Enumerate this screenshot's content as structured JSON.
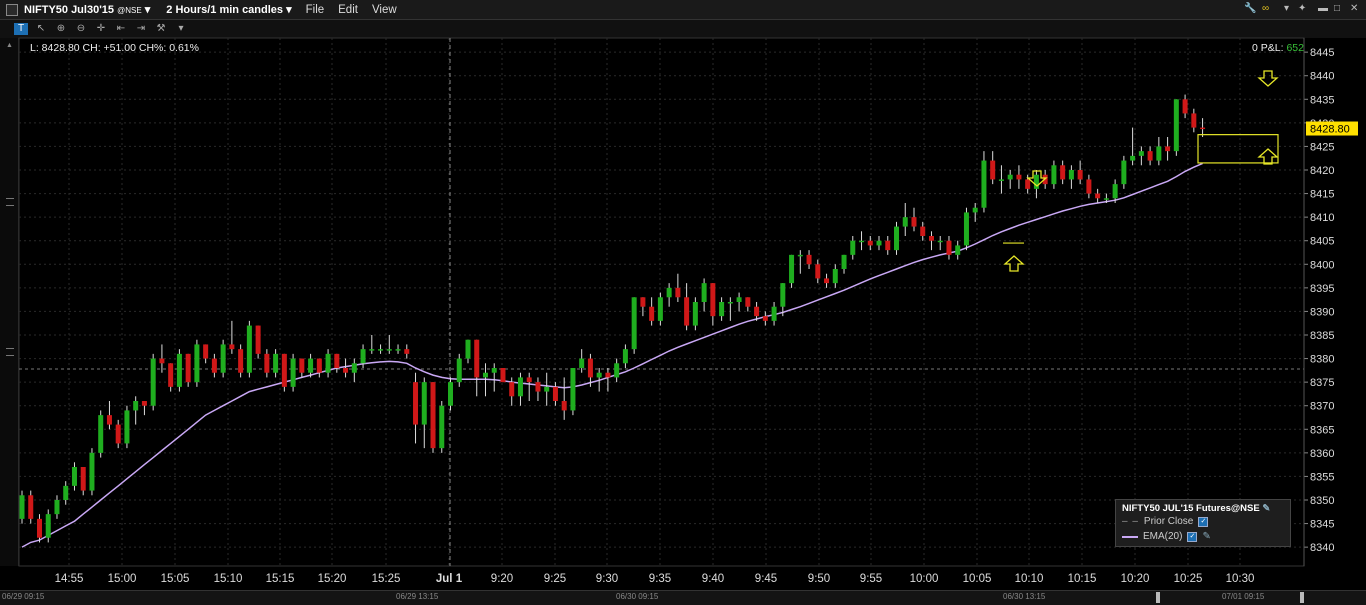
{
  "window": {
    "symbol": "NIFTY50 Jul30'15",
    "exchange": "@NSE",
    "timeframe": "2 Hours/1 min candles",
    "menus": [
      "File",
      "Edit",
      "View"
    ]
  },
  "status": {
    "quote": "L: 8428.80 CH: +51.00 CH%: 0.61%",
    "pnl_label": "0 P&L:",
    "pnl_value": "652"
  },
  "legend": {
    "title": "NIFTY50 JUL'15 Futures@NSE",
    "prior_close": "Prior Close",
    "ema": "EMA(20)"
  },
  "bottom_dates": [
    "06/29 09:15",
    "06/29 13:15",
    "06/30 09:15",
    "06/30 13:15",
    "07/01 09:15"
  ],
  "colors": {
    "up": "#1fae1f",
    "down": "#d01818",
    "ema": "#c9a8f5",
    "highlight": "#e6e628",
    "price_tag": "#ffe000"
  },
  "chart_data": {
    "type": "candlestick",
    "ylim": [
      8336,
      8448
    ],
    "y_ticks": [
      8340,
      8345,
      8350,
      8355,
      8360,
      8365,
      8370,
      8375,
      8380,
      8385,
      8390,
      8395,
      8400,
      8405,
      8410,
      8415,
      8420,
      8425,
      8430,
      8435,
      8440,
      8445
    ],
    "x_ticks": [
      "14:55",
      "15:00",
      "15:05",
      "15:10",
      "15:15",
      "15:20",
      "15:25",
      "Jul 1",
      "9:20",
      "9:25",
      "9:30",
      "9:35",
      "9:40",
      "9:45",
      "9:50",
      "9:55",
      "10:00",
      "10:05",
      "10:10",
      "10:15",
      "10:20",
      "10:25",
      "10:30"
    ],
    "last_price": "8428.80",
    "prior_close": 8377.8,
    "candles": [
      [
        8346,
        8352,
        8345,
        8351
      ],
      [
        8351,
        8352,
        8345,
        8346
      ],
      [
        8346,
        8347,
        8341,
        8342
      ],
      [
        8342,
        8348,
        8341,
        8347
      ],
      [
        8347,
        8351,
        8346,
        8350
      ],
      [
        8350,
        8354,
        8349,
        8353
      ],
      [
        8353,
        8358,
        8352,
        8357
      ],
      [
        8357,
        8357,
        8351,
        8352
      ],
      [
        8352,
        8361,
        8351,
        8360
      ],
      [
        8360,
        8369,
        8359,
        8368
      ],
      [
        8368,
        8371,
        8365,
        8366
      ],
      [
        8366,
        8367,
        8361,
        8362
      ],
      [
        8362,
        8370,
        8361,
        8369
      ],
      [
        8369,
        8372,
        8366,
        8371
      ],
      [
        8371,
        8371,
        8368,
        8370
      ],
      [
        8370,
        8381,
        8369,
        8380
      ],
      [
        8380,
        8383,
        8377,
        8379
      ],
      [
        8379,
        8379,
        8373,
        8374
      ],
      [
        8374,
        8382,
        8373,
        8381
      ],
      [
        8381,
        8381,
        8374,
        8375
      ],
      [
        8375,
        8384,
        8374,
        8383
      ],
      [
        8383,
        8383,
        8379,
        8380
      ],
      [
        8380,
        8381,
        8376,
        8377
      ],
      [
        8377,
        8384,
        8376,
        8383
      ],
      [
        8383,
        8388,
        8381,
        8382
      ],
      [
        8382,
        8383,
        8376,
        8377
      ],
      [
        8377,
        8388,
        8376,
        8387
      ],
      [
        8387,
        8387,
        8380,
        8381
      ],
      [
        8381,
        8382,
        8376,
        8377
      ],
      [
        8377,
        8382,
        8376,
        8381
      ],
      [
        8381,
        8381,
        8373,
        8374
      ],
      [
        8374,
        8381,
        8373,
        8380
      ],
      [
        8380,
        8380,
        8376,
        8377
      ],
      [
        8377,
        8381,
        8376,
        8380
      ],
      [
        8380,
        8380,
        8376,
        8377
      ],
      [
        8377,
        8382,
        8376,
        8381
      ],
      [
        8381,
        8381,
        8377,
        8378
      ],
      [
        8378,
        8380,
        8376,
        8377
      ],
      [
        8377,
        8380,
        8375,
        8379
      ],
      [
        8379,
        8383,
        8378,
        8382
      ],
      [
        8382,
        8385,
        8381,
        8382
      ],
      [
        8382,
        8383,
        8381,
        8382
      ],
      [
        8382,
        8385,
        8381,
        8382
      ],
      [
        8382,
        8383,
        8381,
        8382
      ],
      [
        8382,
        8383,
        8380,
        8381
      ],
      [
        8375,
        8377,
        8362,
        8366
      ],
      [
        8366,
        8376,
        8361,
        8375
      ],
      [
        8375,
        8375,
        8360,
        8361
      ],
      [
        8361,
        8371,
        8360,
        8370
      ],
      [
        8370,
        8376,
        8369,
        8375
      ],
      [
        8375,
        8381,
        8374,
        8380
      ],
      [
        8380,
        8384,
        8379,
        8384
      ],
      [
        8384,
        8384,
        8372,
        8376
      ],
      [
        8376,
        8379,
        8372,
        8377
      ],
      [
        8377,
        8379,
        8373,
        8378
      ],
      [
        8378,
        8378,
        8375,
        8375
      ],
      [
        8375,
        8376,
        8370,
        8372
      ],
      [
        8372,
        8377,
        8370,
        8376
      ],
      [
        8376,
        8377,
        8371,
        8375
      ],
      [
        8375,
        8376,
        8371,
        8373
      ],
      [
        8373,
        8377,
        8370,
        8374
      ],
      [
        8374,
        8375,
        8370,
        8371
      ],
      [
        8371,
        8376,
        8367,
        8369
      ],
      [
        8369,
        8378,
        8368,
        8378
      ],
      [
        8378,
        8382,
        8377,
        8380
      ],
      [
        8380,
        8381,
        8374,
        8376
      ],
      [
        8376,
        8378,
        8373,
        8377
      ],
      [
        8377,
        8378,
        8373,
        8376
      ],
      [
        8376,
        8380,
        8375,
        8379
      ],
      [
        8379,
        8383,
        8378,
        8382
      ],
      [
        8382,
        8393,
        8381,
        8393
      ],
      [
        8393,
        8393,
        8389,
        8391
      ],
      [
        8391,
        8393,
        8387,
        8388
      ],
      [
        8388,
        8394,
        8387,
        8393
      ],
      [
        8393,
        8396,
        8391,
        8395
      ],
      [
        8395,
        8398,
        8392,
        8393
      ],
      [
        8393,
        8396,
        8386,
        8387
      ],
      [
        8387,
        8393,
        8386,
        8392
      ],
      [
        8392,
        8397,
        8390,
        8396
      ],
      [
        8396,
        8396,
        8387,
        8389
      ],
      [
        8389,
        8393,
        8388,
        8392
      ],
      [
        8392,
        8393,
        8388,
        8392
      ],
      [
        8392,
        8394,
        8390,
        8393
      ],
      [
        8393,
        8393,
        8390,
        8391
      ],
      [
        8391,
        8392,
        8388,
        8389
      ],
      [
        8389,
        8390,
        8387,
        8388
      ],
      [
        8388,
        8392,
        8387,
        8391
      ],
      [
        8391,
        8396,
        8389,
        8396
      ],
      [
        8396,
        8402,
        8395,
        8402
      ],
      [
        8402,
        8403,
        8398,
        8402
      ],
      [
        8402,
        8403,
        8399,
        8400
      ],
      [
        8400,
        8401,
        8396,
        8397
      ],
      [
        8397,
        8398,
        8395,
        8396
      ],
      [
        8396,
        8400,
        8395,
        8399
      ],
      [
        8399,
        8402,
        8398,
        8402
      ],
      [
        8402,
        8406,
        8401,
        8405
      ],
      [
        8405,
        8407,
        8403,
        8405
      ],
      [
        8405,
        8406,
        8403,
        8404
      ],
      [
        8404,
        8406,
        8403,
        8405
      ],
      [
        8405,
        8406,
        8402,
        8403
      ],
      [
        8403,
        8409,
        8402,
        8408
      ],
      [
        8408,
        8413,
        8406,
        8410
      ],
      [
        8410,
        8412,
        8407,
        8408
      ],
      [
        8408,
        8409,
        8405,
        8406
      ],
      [
        8406,
        8407,
        8403,
        8405
      ],
      [
        8405,
        8406,
        8403,
        8405
      ],
      [
        8405,
        8406,
        8401,
        8402
      ],
      [
        8402,
        8405,
        8401,
        8404
      ],
      [
        8404,
        8412,
        8403,
        8411
      ],
      [
        8411,
        8413,
        8409,
        8412
      ],
      [
        8412,
        8424,
        8411,
        8422
      ],
      [
        8422,
        8424,
        8417,
        8418
      ],
      [
        8418,
        8421,
        8415,
        8418
      ],
      [
        8418,
        8420,
        8416,
        8419
      ],
      [
        8419,
        8421,
        8416,
        8418
      ],
      [
        8418,
        8419,
        8415,
        8416
      ],
      [
        8416,
        8420,
        8414,
        8419
      ],
      [
        8419,
        8420,
        8416,
        8417
      ],
      [
        8417,
        8422,
        8416,
        8421
      ],
      [
        8421,
        8422,
        8417,
        8418
      ],
      [
        8418,
        8421,
        8416,
        8420
      ],
      [
        8420,
        8422,
        8417,
        8418
      ],
      [
        8418,
        8419,
        8414,
        8415
      ],
      [
        8415,
        8416,
        8413,
        8414
      ],
      [
        8414,
        8415,
        8413,
        8414
      ],
      [
        8414,
        8418,
        8413,
        8417
      ],
      [
        8417,
        8423,
        8416,
        8422
      ],
      [
        8422,
        8429,
        8421,
        8423
      ],
      [
        8423,
        8425,
        8421,
        8424
      ],
      [
        8424,
        8425,
        8421,
        8422
      ],
      [
        8422,
        8427,
        8421,
        8425
      ],
      [
        8425,
        8427,
        8422,
        8424
      ],
      [
        8424,
        8435,
        8423,
        8435
      ],
      [
        8435,
        8436,
        8431,
        8432
      ],
      [
        8432,
        8433,
        8428,
        8429
      ],
      [
        8429,
        8431,
        8427,
        8428.8
      ]
    ],
    "ema20": [
      8340,
      8341,
      8341.5,
      8342.5,
      8343.5,
      8344.5,
      8345.5,
      8347,
      8348.5,
      8350,
      8351.5,
      8353,
      8354.5,
      8356,
      8357.5,
      8359,
      8360.5,
      8362,
      8363.5,
      8365,
      8366.5,
      8368,
      8369,
      8370,
      8371,
      8372,
      8373,
      8373.5,
      8374,
      8374.5,
      8375,
      8375.5,
      8376,
      8376.5,
      8377,
      8377.5,
      8378,
      8378.3,
      8378.6,
      8378.9,
      8379.1,
      8379.3,
      8379.4,
      8379.3,
      8379,
      8378,
      8377.2,
      8376.5,
      8376,
      8375.7,
      8375.6,
      8375.6,
      8375.6,
      8375.6,
      8375.5,
      8375.3,
      8375,
      8374.8,
      8374.6,
      8374.4,
      8374.2,
      8374,
      8373.8,
      8374,
      8374.4,
      8374.9,
      8375.4,
      8376,
      8376.6,
      8377.2,
      8378,
      8378.9,
      8379.8,
      8380.7,
      8381.6,
      8382.4,
      8383.1,
      8383.8,
      8384.5,
      8385.2,
      8385.9,
      8386.6,
      8387.3,
      8387.9,
      8388.4,
      8388.9,
      8389.3,
      8389.8,
      8390.4,
      8391,
      8391.7,
      8392.4,
      8393.1,
      8393.8,
      8394.5,
      8395.3,
      8396.1,
      8396.9,
      8397.6,
      8398.3,
      8399,
      8399.7,
      8400.4,
      8401,
      8401.5,
      8402,
      8402.4,
      8402.8,
      8403.5,
      8404.3,
      8405.2,
      8406.1,
      8406.9,
      8407.6,
      8408.3,
      8408.9,
      8409.5,
      8410.1,
      8410.7,
      8411.3,
      8411.8,
      8412.3,
      8412.7,
      8413,
      8413.3,
      8413.6,
      8414.1,
      8414.8,
      8415.5,
      8416.2,
      8416.9,
      8417.6,
      8418.6,
      8419.7,
      8420.6,
      8421.4
    ]
  }
}
